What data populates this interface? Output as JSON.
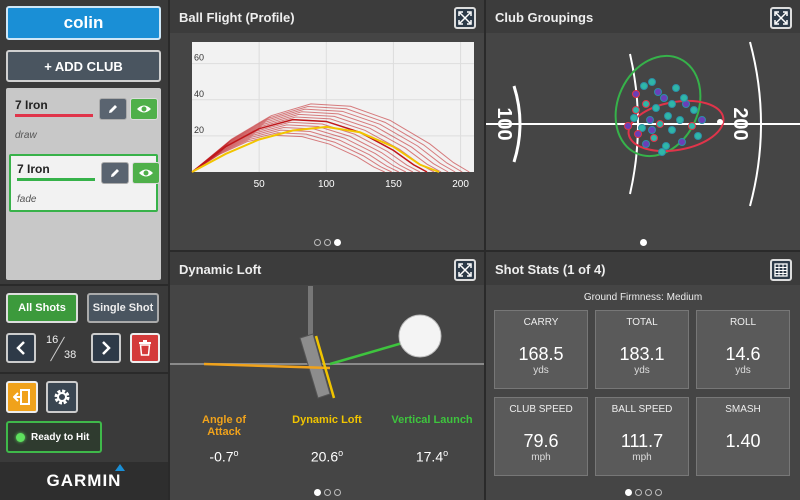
{
  "sidebar": {
    "user": "colin",
    "add_club": "+ ADD CLUB",
    "clubs": [
      {
        "name": "7 Iron",
        "shape": "draw",
        "color": "#e0344a"
      },
      {
        "name": "7 Iron",
        "shape": "fade",
        "color": "#36b24a"
      }
    ],
    "all_shots": "All Shots",
    "single_shot": "Single Shot",
    "shot_index": "16",
    "shot_total": "38",
    "ready": "Ready to Hit",
    "brand": "GARMIN"
  },
  "panels": {
    "ball_flight": {
      "title": "Ball Flight (Profile)",
      "page_dots": 3,
      "active_dot": 2,
      "chart_data": {
        "type": "line",
        "x_ticks": [
          50,
          100,
          150,
          200
        ],
        "y_ticks": [
          20,
          40,
          60
        ],
        "xlim": [
          0,
          210
        ],
        "ylim": [
          0,
          72
        ],
        "series": [
          {
            "color": "#c0171b",
            "x": [
              0,
              25,
              50,
              75,
              100,
              125,
              150,
              165,
              175
            ],
            "y": [
              0,
              14,
              24,
              29,
              28,
              22,
              12,
              4,
              0
            ]
          },
          {
            "color": "#f2c400",
            "x": [
              0,
              25,
              50,
              75,
              100,
              125,
              150,
              170,
              184
            ],
            "y": [
              0,
              10,
              18,
              23,
              25,
              22,
              14,
              4,
              0
            ]
          }
        ]
      }
    },
    "club_groupings": {
      "title": "Club Groupings",
      "page_dots": 1,
      "active_dot": 0,
      "range_left": "100",
      "range_right": "200"
    },
    "dynamic_loft": {
      "title": "Dynamic Loft",
      "page_dots": 3,
      "active_dot": 0,
      "metrics": [
        {
          "label_line1": "Angle of",
          "label_line2": "Attack",
          "value": "-0.7",
          "color": "#f0a21b"
        },
        {
          "label_line1": "Dynamic Loft",
          "label_line2": "",
          "value": "20.6",
          "color": "#f0c400"
        },
        {
          "label_line1": "Vertical Launch",
          "label_line2": "",
          "value": "17.4",
          "color": "#3ec43e"
        }
      ],
      "degree_symbol": "o"
    },
    "shot_stats": {
      "title": "Shot Stats (1 of 4)",
      "page_dots": 4,
      "active_dot": 0,
      "firmness": "Ground Firmness: Medium",
      "stats": [
        {
          "label": "CARRY",
          "value": "168.5",
          "unit": "yds"
        },
        {
          "label": "TOTAL",
          "value": "183.1",
          "unit": "yds"
        },
        {
          "label": "ROLL",
          "value": "14.6",
          "unit": "yds"
        },
        {
          "label": "CLUB SPEED",
          "value": "79.6",
          "unit": "mph"
        },
        {
          "label": "BALL SPEED",
          "value": "111.7",
          "unit": "mph"
        },
        {
          "label": "SMASH",
          "value": "1.40",
          "unit": ""
        }
      ]
    }
  }
}
